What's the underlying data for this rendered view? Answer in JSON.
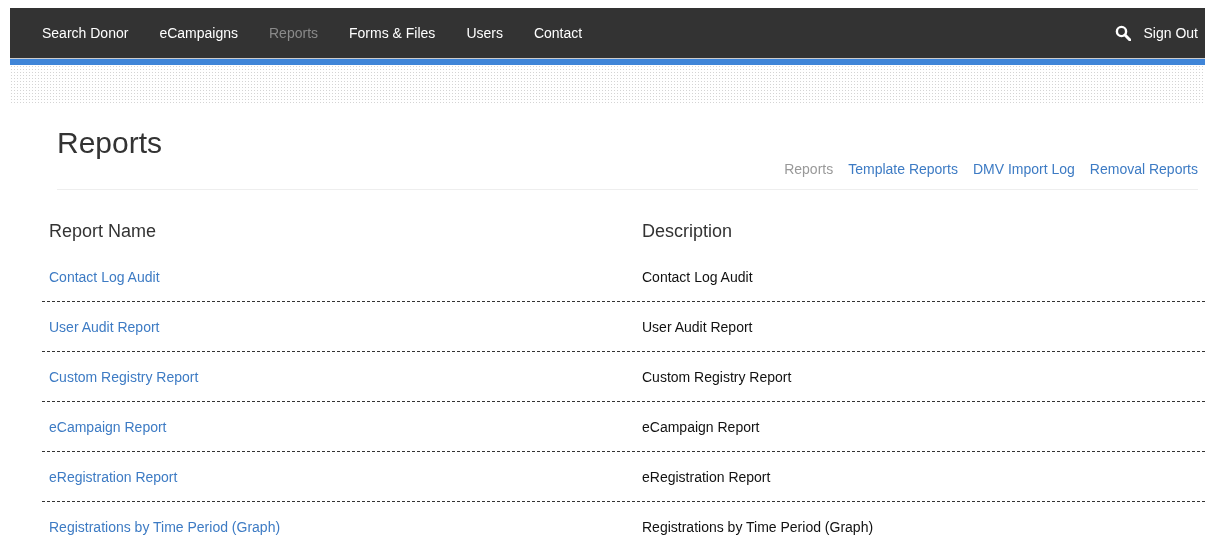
{
  "nav": {
    "items": [
      {
        "label": "Search Donor",
        "selected": false
      },
      {
        "label": "eCampaigns",
        "selected": false
      },
      {
        "label": "Reports",
        "selected": true
      },
      {
        "label": "Forms & Files",
        "selected": false
      },
      {
        "label": "Users",
        "selected": false
      },
      {
        "label": "Contact",
        "selected": false
      }
    ],
    "sign_out": "Sign Out"
  },
  "page": {
    "title": "Reports",
    "subnav": [
      {
        "label": "Reports",
        "selected": true
      },
      {
        "label": "Template Reports",
        "selected": false
      },
      {
        "label": "DMV Import Log",
        "selected": false
      },
      {
        "label": "Removal Reports",
        "selected": false
      }
    ]
  },
  "table": {
    "columns": [
      "Report Name",
      "Description"
    ],
    "rows": [
      {
        "name": "Contact Log Audit",
        "description": "Contact Log Audit"
      },
      {
        "name": "User Audit Report",
        "description": "User Audit Report"
      },
      {
        "name": "Custom Registry Report",
        "description": "Custom Registry Report"
      },
      {
        "name": "eCampaign Report",
        "description": "eCampaign Report"
      },
      {
        "name": "eRegistration Report",
        "description": "eRegistration Report"
      },
      {
        "name": "Registrations by Time Period (Graph)",
        "description": "Registrations by Time Period (Graph)"
      }
    ]
  }
}
